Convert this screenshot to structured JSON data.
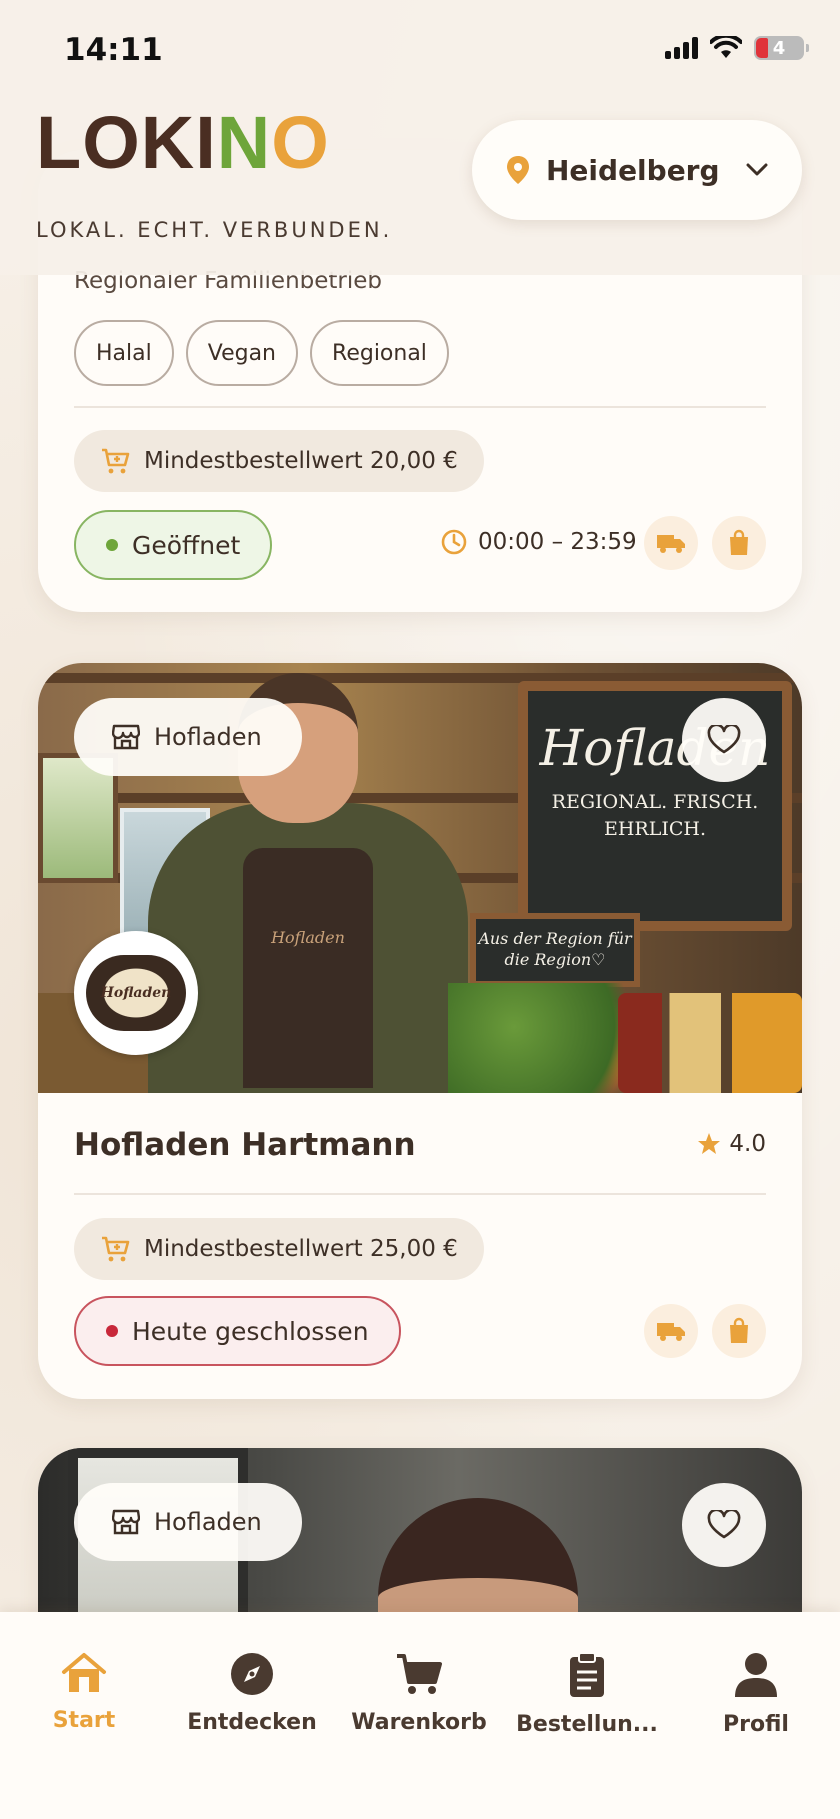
{
  "status_bar": {
    "time": "14:11",
    "battery": "4"
  },
  "header": {
    "logo": {
      "part1": "LOKI",
      "part2": "N",
      "part3": "O"
    },
    "tagline": "LOKAL. ECHT. VERBUNDEN.",
    "location": "Heidelberg"
  },
  "card1": {
    "subtitle": "Regionaler Familienbetrieb",
    "tags": [
      "Halal",
      "Vegan",
      "Regional"
    ],
    "min_order": "Mindestbestellwert 20,00 €",
    "status": "Geöffnet",
    "hours": "00:00 – 23:59"
  },
  "card2": {
    "category": "Hofladen",
    "name": "Hofladen Hartmann",
    "rating": "4.0",
    "min_order": "Mindestbestellwert 25,00 €",
    "status": "Heute geschlossen",
    "image": {
      "chalk_title": "Hofladen",
      "chalk_sub": "REGIONAL. FRISCH. EHRLICH.",
      "sign": "Aus der Region für die Region♡",
      "apron": "Hofladen",
      "logo": "Hofladen"
    }
  },
  "card3": {
    "category": "Hofladen"
  },
  "nav": {
    "items": [
      {
        "label": "Start",
        "icon": "home-icon",
        "active": true
      },
      {
        "label": "Entdecken",
        "icon": "compass-icon"
      },
      {
        "label": "Warenkorb",
        "icon": "cart-icon"
      },
      {
        "label": "Bestellun...",
        "icon": "clipboard-icon"
      },
      {
        "label": "Profil",
        "icon": "user-icon"
      }
    ]
  },
  "colors": {
    "accent": "#e9a23b",
    "brand_brown": "#4a2e22",
    "brand_green": "#6ea53a",
    "open_green": "#6ea53a",
    "closed_red": "#c8283a"
  }
}
